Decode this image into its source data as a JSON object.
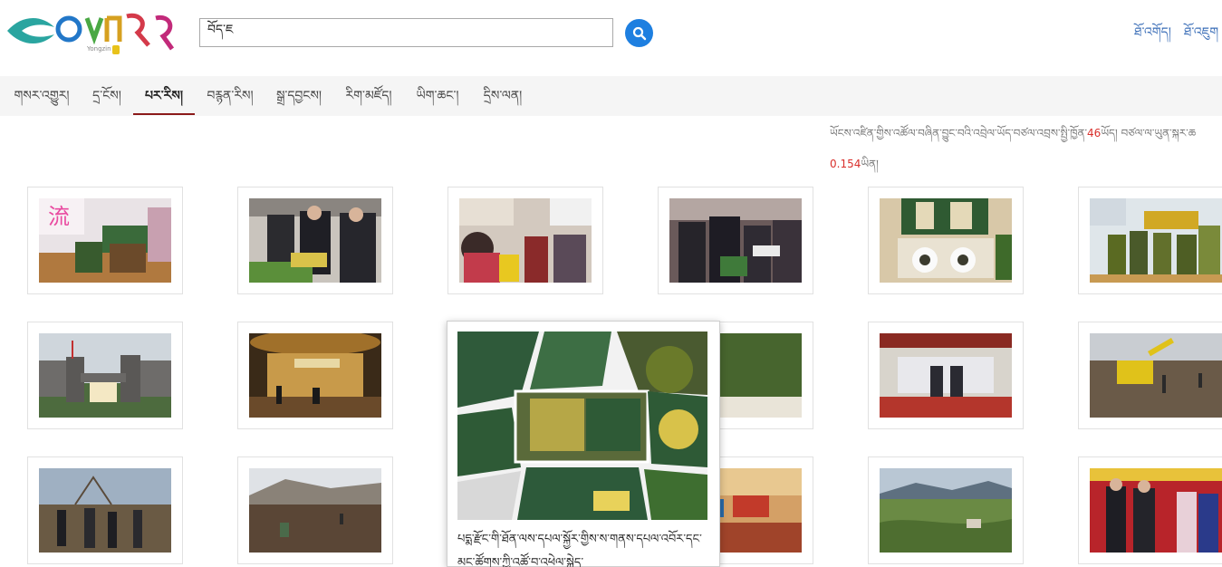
{
  "header": {
    "search": {
      "value": "བོད་ཇ",
      "placeholder": ""
    },
    "links": [
      "ཐོ་འགོད།",
      "ཐོ་འཇུག"
    ]
  },
  "nav": [
    {
      "label": "གསར་འགྱུར།",
      "active": false
    },
    {
      "label": "དྲ་ངོས།",
      "active": false
    },
    {
      "label": "པར་རིས།",
      "active": true
    },
    {
      "label": "བརྙན་རིས།",
      "active": false
    },
    {
      "label": "སྒྲ་དབྱངས།",
      "active": false
    },
    {
      "label": "རིག་མཛོད།",
      "active": false
    },
    {
      "label": "ཡིག་ཆང་།",
      "active": false
    },
    {
      "label": "དྲིས་ལན།",
      "active": false
    }
  ],
  "stats": {
    "prefix": "ཡོངས་འཛིན་གྱིས་འཚོལ་བཞིན་བྱུང་བའི་འབྲེལ་ཡོད་བཙལ་འབྲས་སྤྱི་ཁྱོན་",
    "count": "46",
    "mid": "ཡོད། བཙལ་ལ་ཡུན་སྐར་ཆ",
    "time": "0.154",
    "suffix": "ཡིན།"
  },
  "popup": {
    "caption": "པདྨ་རྫོང་གི་ཐོན་ལས་དཔལ་སྐྱོར་གྱིས་ས་གནས་དཔལ་འབོར་དང་མང་ཚོགས་ཀྱི་འཚོ་བ་འཕེལ་སྐྱེད་"
  }
}
